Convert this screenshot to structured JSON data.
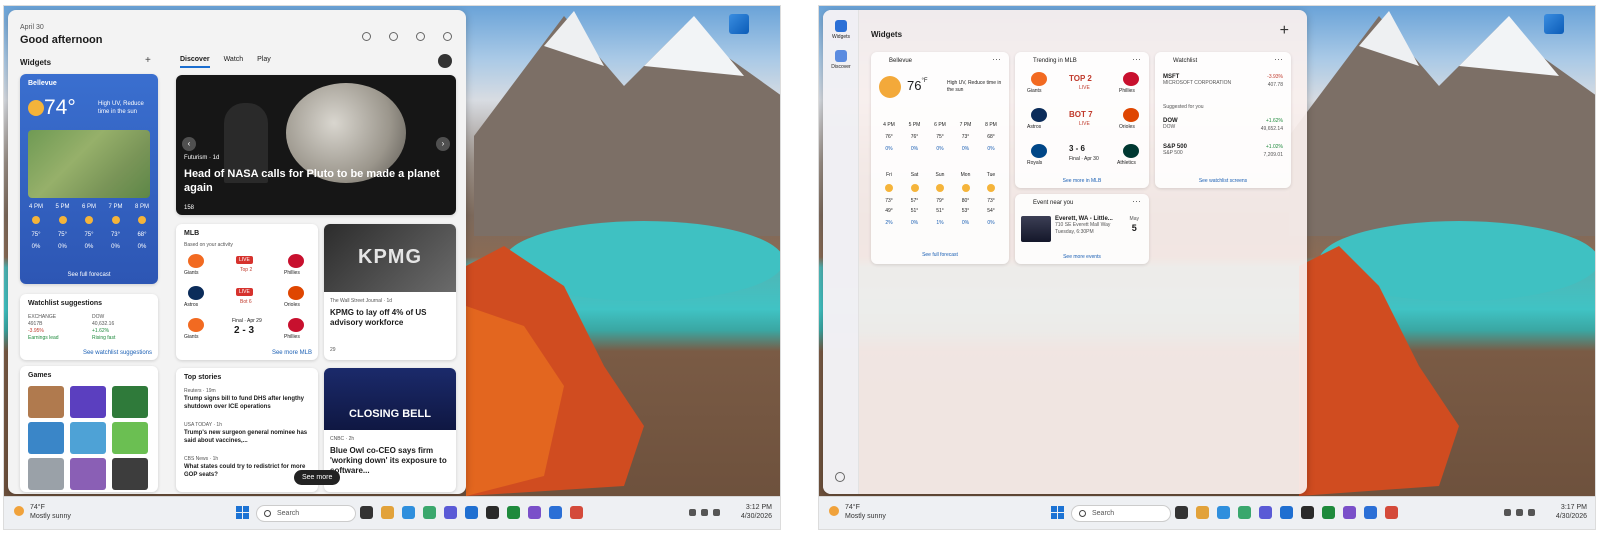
{
  "left": {
    "date": "April 30",
    "greeting": "Good afternoon",
    "widgets_label": "Widgets",
    "weather": {
      "city": "Bellevue",
      "temp": "74°",
      "unit": "°F",
      "desc": "High UV, Reduce time in the sun",
      "hours": [
        "4 PM",
        "5 PM",
        "6 PM",
        "7 PM",
        "8 PM"
      ],
      "temps": [
        "75°",
        "75°",
        "75°",
        "73°",
        "68°"
      ],
      "precip": [
        "0%",
        "0%",
        "0%",
        "0%",
        "0%"
      ],
      "link": "See full forecast"
    },
    "watchlist": {
      "title": "Watchlist suggestions",
      "items": [
        {
          "name": "EXCHANGE",
          "value": "4917B",
          "change": "-3.95%"
        },
        {
          "name": "DOW",
          "value": "40,632.16",
          "change": "+1.62%"
        }
      ],
      "earnings": "Earnings lead",
      "rising": "Rising fast",
      "link": "See watchlist suggestions"
    },
    "games_title": "Games",
    "tabs": [
      "Discover",
      "Watch",
      "Play"
    ],
    "hero": {
      "source": "Futurism · 1d",
      "title": "Head of NASA calls for Pluto to be made a planet again",
      "likes": "158"
    },
    "mlb": {
      "title": "MLB",
      "subtitle": "Based on your activity",
      "rows": [
        {
          "home": "Giants",
          "away": "Phillies",
          "status": "LIVE",
          "detail": "Top 2"
        },
        {
          "home": "Astros",
          "away": "Orioles",
          "status": "LIVE",
          "detail": "Bot 6"
        },
        {
          "home": "Giants",
          "away": "Phillies",
          "status": "2 - 3",
          "detail": "Final · Apr 29"
        }
      ],
      "link": "See more MLB"
    },
    "kpmg": {
      "img_text": "KPMG",
      "source": "The Wall Street Journal · 1d",
      "title": "KPMG to lay off 4% of US advisory workforce",
      "likes": "29"
    },
    "top_stories": {
      "title": "Top stories",
      "items": [
        {
          "source": "Reuters · 19m",
          "title": "Trump signs bill to fund DHS after lengthy shutdown over ICE operations"
        },
        {
          "source": "USA TODAY · 1h",
          "title": "Trump's new surgeon general nominee has said about vaccines,..."
        },
        {
          "source": "CBS News · 1h",
          "title": "What states could try to redistrict for more GOP seats?"
        }
      ]
    },
    "closing": {
      "img_text": "CLOSING BELL",
      "source": "CNBC · 2h",
      "title": "Blue Owl co-CEO says firm 'working down' its exposure to software..."
    },
    "see_more": "See more"
  },
  "right": {
    "nav": [
      "Widgets",
      "Discover"
    ],
    "title": "Widgets",
    "weather": {
      "city": "Bellevue",
      "temp": "76",
      "unit": "°F",
      "desc": "High UV, Reduce time in the sun",
      "hours": [
        "4 PM",
        "5 PM",
        "6 PM",
        "7 PM",
        "8 PM"
      ],
      "temps": [
        "76°",
        "76°",
        "75°",
        "73°",
        "68°"
      ],
      "precip": [
        "0%",
        "0%",
        "0%",
        "0%",
        "0%"
      ],
      "days": [
        "Fri",
        "Sat",
        "Sun",
        "Mon",
        "Tue"
      ],
      "highs": [
        "73°",
        "57°",
        "79°",
        "80°",
        "73°"
      ],
      "lows": [
        "49°",
        "51°",
        "51°",
        "53°",
        "54°"
      ],
      "dprecip": [
        "2%",
        "0%",
        "1%",
        "0%",
        "0%"
      ],
      "link": "See full forecast"
    },
    "trending": {
      "title": "Trending in MLB",
      "games": [
        {
          "home": "Giants",
          "away": "Phillies",
          "status": "TOP 2",
          "detail": "LIVE"
        },
        {
          "home": "Astros",
          "away": "Orioles",
          "status": "BOT 7",
          "detail": "LIVE"
        },
        {
          "home": "Royals",
          "away": "Athletics",
          "status": "3 - 6",
          "detail": "Final · Apr 30"
        }
      ],
      "link": "See more in MLB"
    },
    "watchlist": {
      "title": "Watchlist",
      "items": [
        {
          "name": "MSFT",
          "sub": "MICROSOFT CORPORATION",
          "change": "-3.93%",
          "value": "407.78"
        }
      ],
      "suggested": "Suggested for you",
      "suggestions": [
        {
          "name": "DOW",
          "sub": "DOW",
          "change": "+1.62%",
          "value": "49,652.14"
        },
        {
          "name": "S&P 500",
          "sub": "S&P 500",
          "change": "+1.02%",
          "value": "7,209.01"
        }
      ],
      "link": "See watchlist screens"
    },
    "event": {
      "title": "Event near you",
      "name": "Everett, WA - Little...",
      "place": "710 SE Everett Mall Way",
      "time": "Tuesday, 6:30PM",
      "month": "May",
      "day": "5",
      "link": "See more events"
    }
  },
  "taskbar": {
    "temp": "74°F",
    "cond": "Mostly sunny",
    "search": "Search",
    "time_left": "3:12 PM",
    "time_right": "3:17 PM",
    "date": "4/30/2026"
  },
  "colors": {
    "accent": "#1b6ed0",
    "live": "#d6322d",
    "weather_card": "#3a6fcf"
  }
}
